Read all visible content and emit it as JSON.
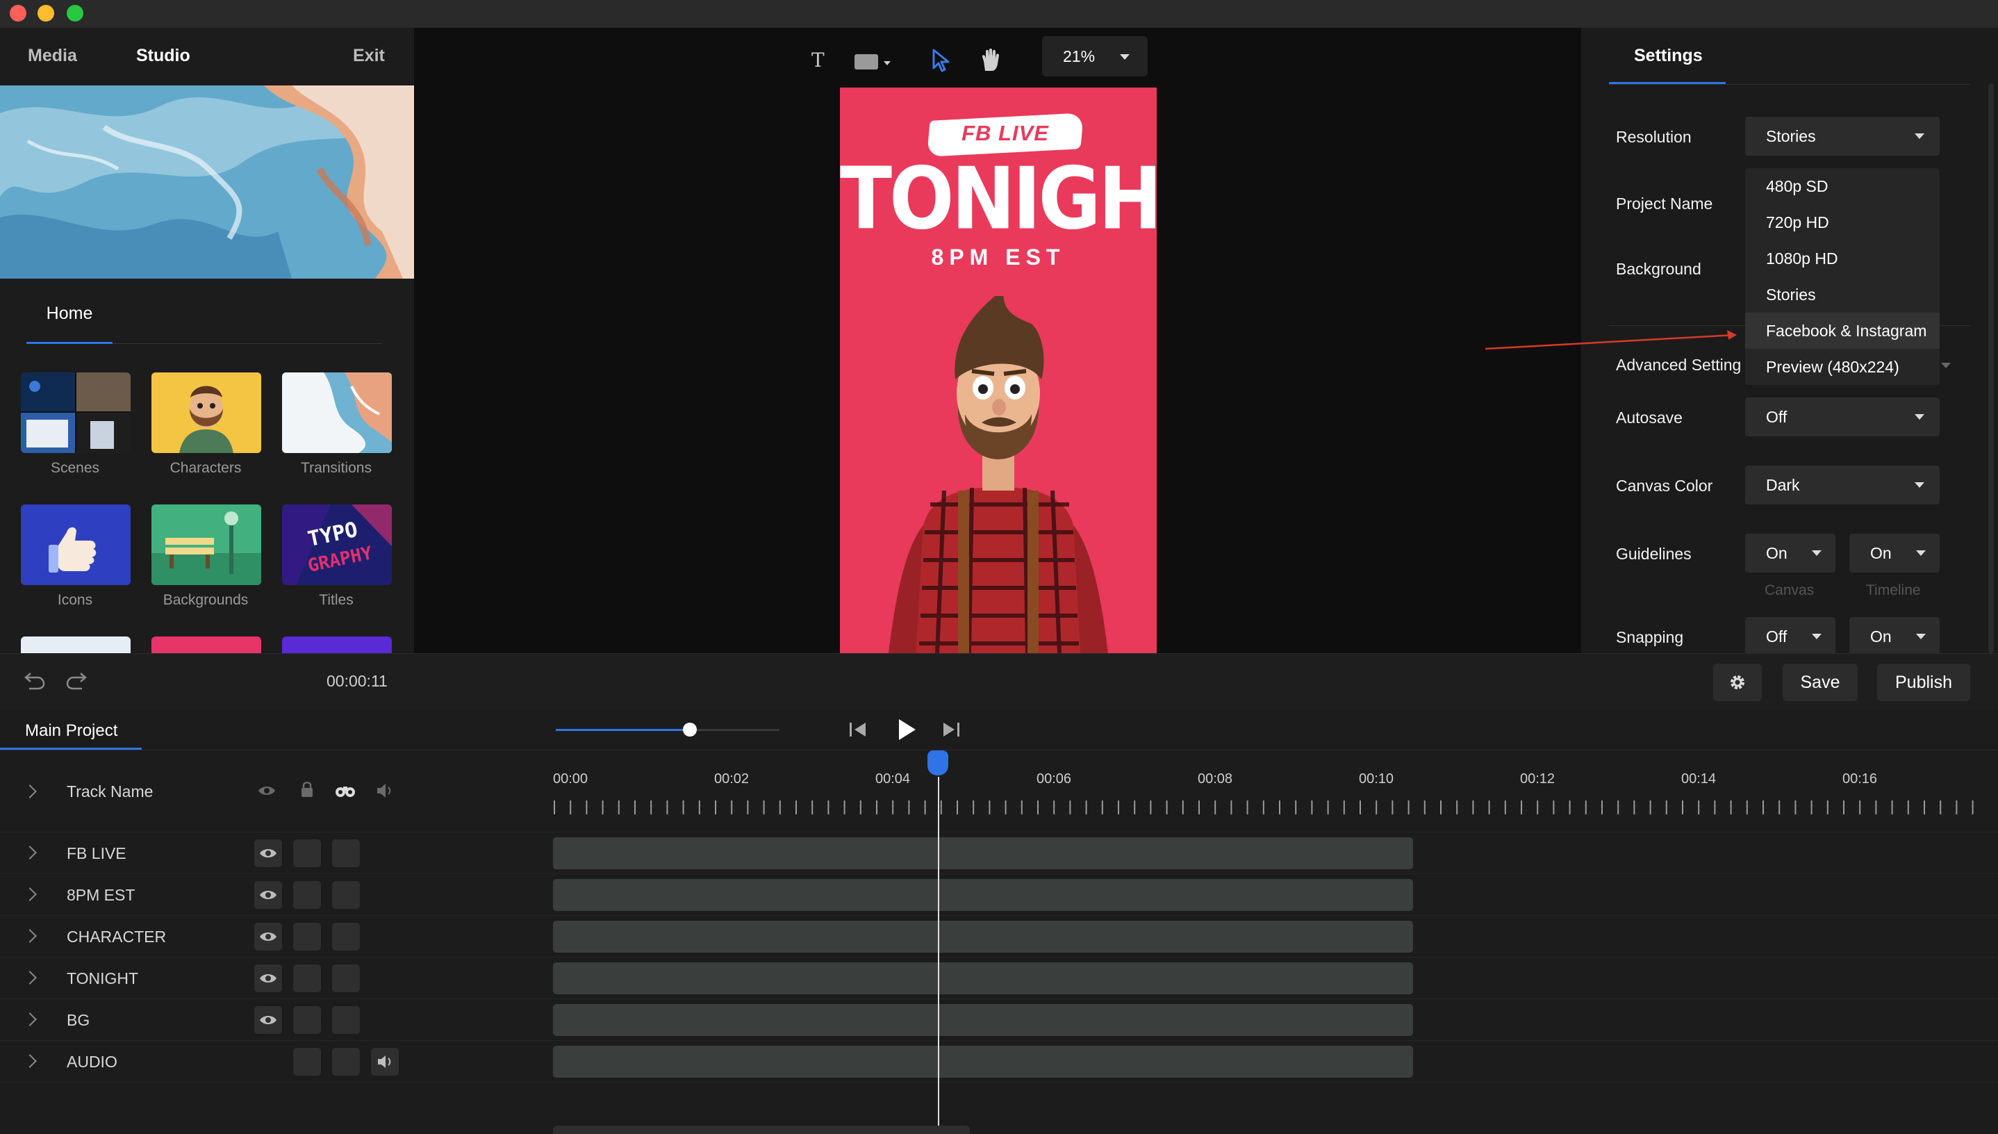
{
  "left_panel": {
    "tabs": [
      "Media",
      "Studio",
      "Exit"
    ],
    "home_tab": "Home",
    "library": [
      {
        "label": "Scenes",
        "icon": "scenes-thumbnail"
      },
      {
        "label": "Characters",
        "icon": "characters-thumbnail"
      },
      {
        "label": "Transitions",
        "icon": "transitions-thumbnail"
      },
      {
        "label": "Icons",
        "icon": "icons-thumbnail"
      },
      {
        "label": "Backgrounds",
        "icon": "backgrounds-thumbnail"
      },
      {
        "label": "Titles",
        "icon": "titles-thumbnail"
      }
    ],
    "titles_thumb_text": {
      "line1": "TYPO",
      "line2": "GRAPHY"
    }
  },
  "canvas": {
    "zoom": "21%",
    "poster": {
      "tag": "FB LIVE",
      "headline": "TONIGHT",
      "time": "8PM EST"
    },
    "colors": {
      "poster_bg": "#e93a5b"
    }
  },
  "settings": {
    "title": "Settings",
    "labels": {
      "resolution": "Resolution",
      "project_name": "Project Name",
      "background": "Background",
      "advanced": "Advanced Setting",
      "autosave": "Autosave",
      "canvas_color": "Canvas Color",
      "guidelines": "Guidelines",
      "snapping": "Snapping"
    },
    "resolution_value": "Stories",
    "resolution_options": [
      "480p SD",
      "720p HD",
      "1080p HD",
      "Stories",
      "Facebook & Instagram",
      "Preview (480x224)"
    ],
    "highlighted_option": 4,
    "autosave_value": "Off",
    "canvas_color_value": "Dark",
    "guidelines": {
      "canvas": "On",
      "timeline": "On",
      "canvas_label": "Canvas",
      "timeline_label": "Timeline"
    },
    "snapping": {
      "canvas": "Off",
      "timeline": "On"
    }
  },
  "toolbar": {
    "timecode": "00:00:11",
    "save_label": "Save",
    "publish_label": "Publish"
  },
  "timeline": {
    "project_tab": "Main Project",
    "header_label": "Track Name",
    "tracks": [
      "FB LIVE",
      "8PM EST",
      "CHARACTER",
      "TONIGHT",
      "BG",
      "AUDIO"
    ],
    "time_labels": [
      "00:00",
      "00:02",
      "00:04",
      "00:06",
      "00:08",
      "00:10",
      "00:12",
      "00:14",
      "00:16"
    ],
    "volume_progress": 0.6
  }
}
